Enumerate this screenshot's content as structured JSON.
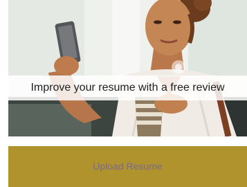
{
  "promo": {
    "headline": "Improve your resume with a free review",
    "image_subject": "woman-checking-phone-photo"
  },
  "actions": {
    "upload_label": "Upload Resume"
  },
  "colors": {
    "button_background": "#b0932d",
    "button_text": "#7b6a8f",
    "banner_background": "#ffffff",
    "headline_text": "#1e1e1e"
  }
}
